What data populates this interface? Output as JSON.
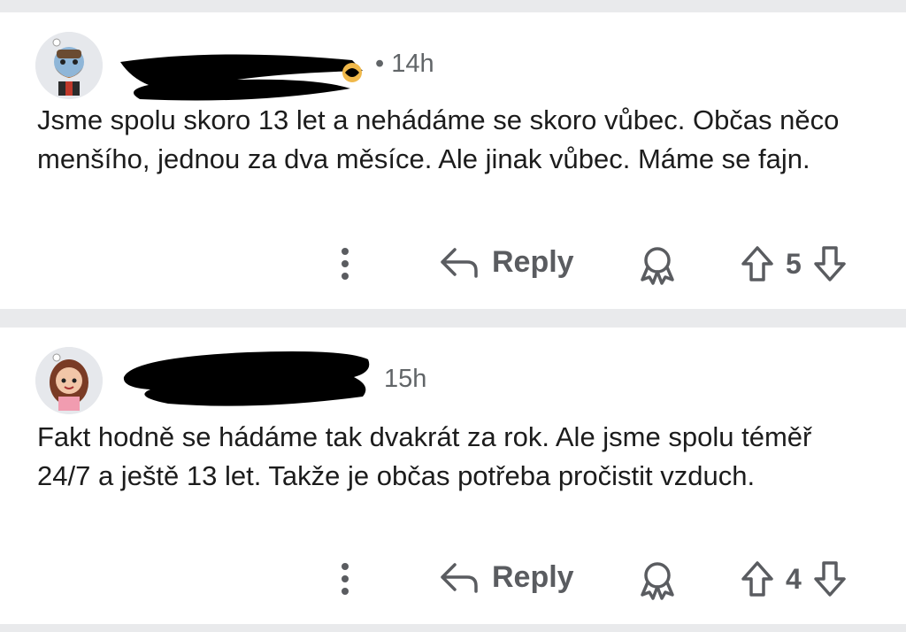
{
  "comments": [
    {
      "time": "• 14h",
      "text": "Jsme spolu skoro 13 let a nehádáme se skoro vůbec. Občas něco menšího, jednou za dva měsíce. Ale jinak vůbec. Máme se fajn.",
      "reply_label": "Reply",
      "votes": "5"
    },
    {
      "time": "15h",
      "text": "Fakt hodně se hádáme tak dvakrát za rok. Ale jsme spolu téměř 24/7 a ještě 13 let. Takže je občas potřeba pročistit vzduch.",
      "reply_label": "Reply",
      "votes": "4"
    }
  ],
  "icons": {
    "more": "more-vertical-icon",
    "reply": "reply-arrow-icon",
    "award": "award-icon",
    "upvote": "upvote-icon",
    "downvote": "downvote-icon"
  },
  "colors": {
    "background": "#e9eaec",
    "card": "#ffffff",
    "text": "#1c1c1c",
    "meta": "#616568",
    "icon": "#5a5c60"
  }
}
